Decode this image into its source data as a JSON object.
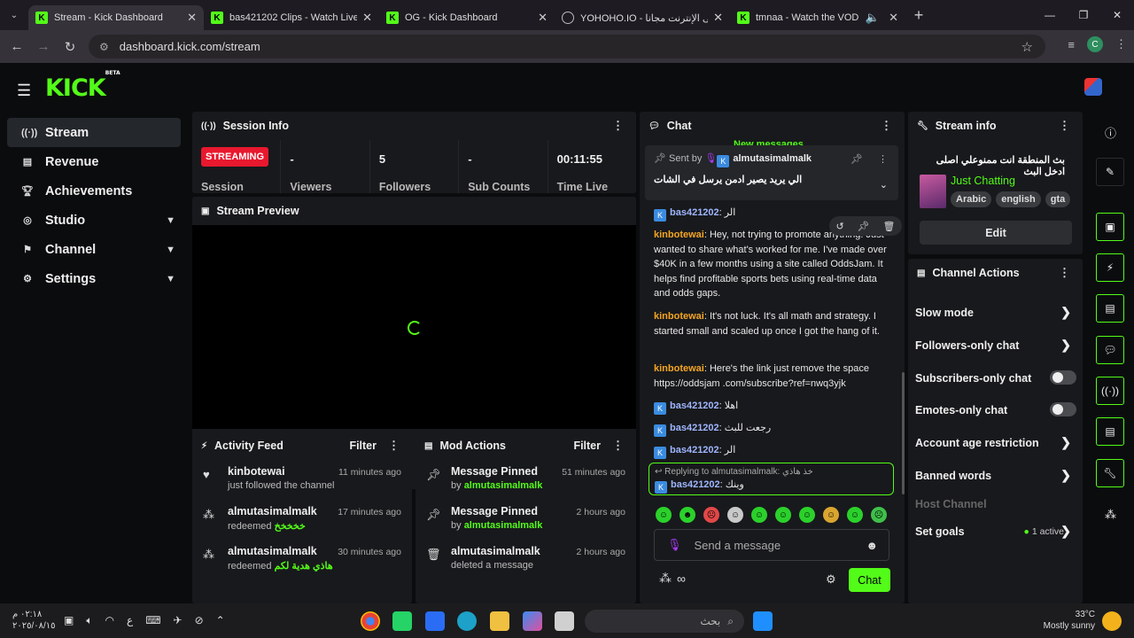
{
  "browser": {
    "tabs": [
      {
        "title": "Stream - Kick Dashboard",
        "active": true
      },
      {
        "title": "bas421202 Clips - Watch Live o",
        "active": false
      },
      {
        "title": "OG - Kick Dashboard",
        "active": false
      },
      {
        "title": "YOHOHO.IO - على الإنترنت مجانا",
        "active": false
      },
      {
        "title": "tmnaa - Watch the VOD on",
        "active": false
      }
    ],
    "url": "dashboard.kick.com/stream",
    "profile_initial": "C"
  },
  "logo": "KICK",
  "logo_badge": "BETA",
  "sidebar": {
    "items": [
      {
        "label": "Stream",
        "icon": "broadcast-icon"
      },
      {
        "label": "Revenue",
        "icon": "revenue-icon"
      },
      {
        "label": "Achievements",
        "icon": "trophy-icon"
      },
      {
        "label": "Studio",
        "icon": "studio-icon"
      },
      {
        "label": "Channel",
        "icon": "channel-icon"
      },
      {
        "label": "Settings",
        "icon": "gear-icon"
      }
    ]
  },
  "session": {
    "title": "Session Info",
    "status": "STREAMING",
    "stats": [
      {
        "value": "",
        "label": "Session"
      },
      {
        "value": "-",
        "label": "Viewers"
      },
      {
        "value": "5",
        "label": "Followers"
      },
      {
        "value": "-",
        "label": "Sub Counts"
      },
      {
        "value": "00:11:55",
        "label": "Time Live"
      }
    ]
  },
  "preview": {
    "title": "Stream Preview"
  },
  "activity": {
    "title": "Activity Feed",
    "filter": "Filter",
    "items": [
      {
        "name": "kinbotewai",
        "sub": "just followed the channel",
        "extra": "",
        "time": "11 minutes ago"
      },
      {
        "name": "almutasimalmalk",
        "sub": "redeemed",
        "extra": "خخخخخ",
        "time": "17 minutes ago"
      },
      {
        "name": "almutasimalmalk",
        "sub": "redeemed",
        "extra": "هاذي هدية لكم",
        "time": "30 minutes ago"
      }
    ]
  },
  "mod": {
    "title": "Mod Actions",
    "filter": "Filter",
    "items": [
      {
        "name": "Message Pinned",
        "sub": "by",
        "extra": "almutasimalmalk",
        "time": "51 minutes ago"
      },
      {
        "name": "Message Pinned",
        "sub": "by",
        "extra": "almutasimalmalk",
        "time": "2 hours ago"
      },
      {
        "name": "almutasimalmalk",
        "sub": "deleted a message",
        "extra": "",
        "time": "2 hours ago"
      }
    ]
  },
  "chat": {
    "title": "Chat",
    "new_messages": "New messages",
    "pinned": {
      "sent_by": "Sent by",
      "user": "almutasimalmalk",
      "message": "الي يريد يصير ادمن يرسل في الشات"
    },
    "messages": [
      {
        "user": "bas421202",
        "text": "الر"
      },
      {
        "user": "kinbotewai",
        "text": "Hey, not trying to promote anything. Just wanted to share what's worked for me. I've made over $40K in a few months using a site called OddsJam. It helps find profitable sports bets using real-time data and odds gaps."
      },
      {
        "user": "kinbotewai",
        "text": "It's not luck. It's all math and strategy. I started small and scaled up once I got the hang of it."
      },
      {
        "user": "kinbotewai",
        "text": "Here's the link just remove the space https://oddsjam .com/subscribe?ref=nwq3yjk"
      },
      {
        "user": "bas421202",
        "text": "اهلا"
      },
      {
        "user": "bas421202",
        "text": "رجعت للبث"
      },
      {
        "user": "bas421202",
        "text": "الر"
      }
    ],
    "reply": {
      "label": "Replying to almutasimalmalk:",
      "quote": "خذ هاذي",
      "user": "bas421202",
      "text": "وينك"
    },
    "placeholder": "Send a message",
    "send_label": "Chat"
  },
  "stream_info": {
    "title": "Stream info",
    "stream_title": "بث المنطقة انت ممنوعلي اصلى ادخل البث",
    "category": "Just Chatting",
    "tags": [
      "Arabic",
      "english",
      "gta"
    ],
    "edit": "Edit"
  },
  "channel_actions": {
    "title": "Channel Actions",
    "items": [
      {
        "label": "Slow mode",
        "kind": "arrow"
      },
      {
        "label": "Followers-only chat",
        "kind": "arrow"
      },
      {
        "label": "Subscribers-only chat",
        "kind": "toggle"
      },
      {
        "label": "Emotes-only chat",
        "kind": "toggle"
      },
      {
        "label": "Account age restriction",
        "kind": "arrow"
      },
      {
        "label": "Banned words",
        "kind": "arrow"
      },
      {
        "label": "Host Channel",
        "kind": "disabled"
      },
      {
        "label": "Set goals",
        "kind": "arrow",
        "extra": "1 active"
      }
    ]
  },
  "taskbar": {
    "time": "٠٢:١٨ م",
    "date": "٢٠٢٥/٠٨/١٥",
    "lang": "ع",
    "search": "بحث",
    "temp": "33°C",
    "weather": "Mostly sunny"
  }
}
